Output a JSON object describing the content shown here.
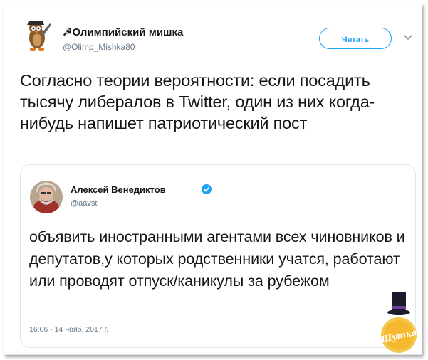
{
  "tweet": {
    "author_name": "Олимпийский мишка",
    "author_handle": "@Olimp_Mishka80",
    "follow_label": "Читать",
    "text": "Согласно теории вероятности: если посадить тысячу либералов в Twitter, один из них когда-нибудь напишет патриотический пост"
  },
  "quoted_tweet": {
    "author_name": "Алексей Венедиктов",
    "author_handle": "@aavst",
    "text": "объявить иностранными агентами всех чиновников и депутатов,у которых родственники учатся, работают или проводят отпуск/каникулы за рубежом",
    "timestamp": "16:06 - 14 нояб. 2017 г."
  },
  "watermark": {
    "text": "Шутка"
  },
  "colors": {
    "accent": "#1da1f2",
    "muted": "#657786",
    "border": "#e1e8ed"
  },
  "icons": [
    "avatar-icon",
    "chevron-down-icon",
    "verified-badge-icon",
    "top-hat-icon",
    "watermark-logo"
  ]
}
